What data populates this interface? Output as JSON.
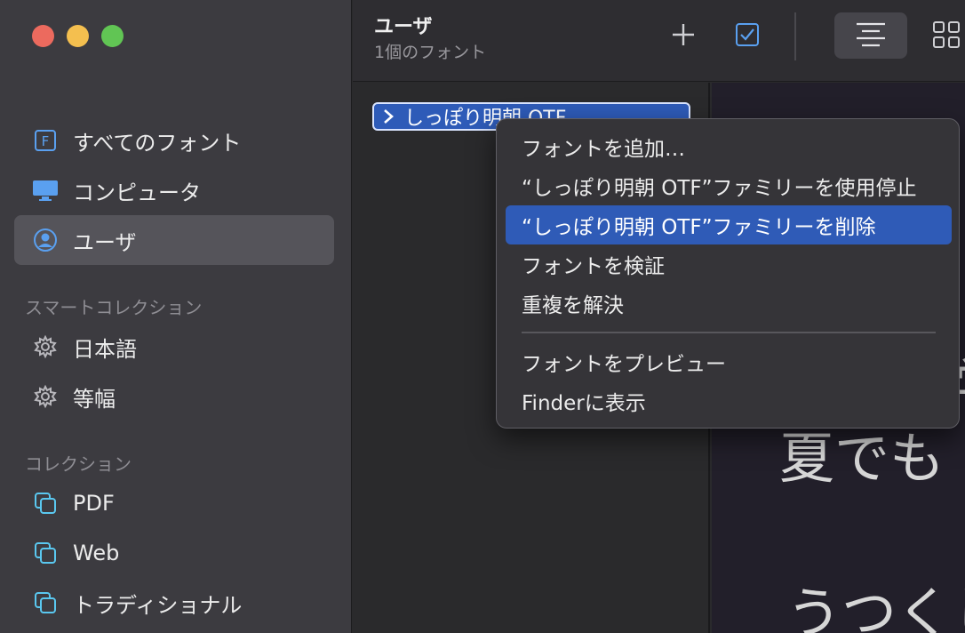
{
  "window": {
    "title": "ユーザ",
    "subtitle": "1個のフォント"
  },
  "sidebar": {
    "items": [
      {
        "label": "すべてのフォント",
        "icon": "font-book-icon"
      },
      {
        "label": "コンピュータ",
        "icon": "display-icon"
      },
      {
        "label": "ユーザ",
        "icon": "user-circle-icon",
        "selected": true
      }
    ],
    "smart_header": "スマートコレクション",
    "smart_items": [
      {
        "label": "日本語",
        "icon": "gear-icon"
      },
      {
        "label": "等幅",
        "icon": "gear-icon"
      }
    ],
    "collections_header": "コレクション",
    "collections": [
      {
        "label": "PDF",
        "icon": "collection-icon"
      },
      {
        "label": "Web",
        "icon": "collection-icon"
      },
      {
        "label": "トラディショナル",
        "icon": "collection-icon"
      }
    ]
  },
  "font_list": {
    "selected_font": "しっぽり明朝 OTF"
  },
  "preview": {
    "lines": [
      "夏でも",
      "うつくし"
    ],
    "partial_glyphs": [
      "〈",
      "学"
    ]
  },
  "context_menu": {
    "items": [
      {
        "label": "フォントを追加…"
      },
      {
        "label": "“しっぽり明朝 OTF”ファミリーを使用停止"
      },
      {
        "label": "“しっぽり明朝 OTF”ファミリーを削除",
        "highlighted": true
      },
      {
        "label": "フォントを検証"
      },
      {
        "label": "重複を解決"
      },
      {
        "label": "フォントをプレビュー"
      },
      {
        "label": "Finderに表示"
      }
    ]
  },
  "colors": {
    "accent": "#2f5bb7",
    "sidebar_bg": "#3c3b40",
    "icon_blue": "#5aa0f0",
    "close": "#ec6a5e",
    "minimize": "#f4bf4f",
    "zoom": "#61c554"
  }
}
